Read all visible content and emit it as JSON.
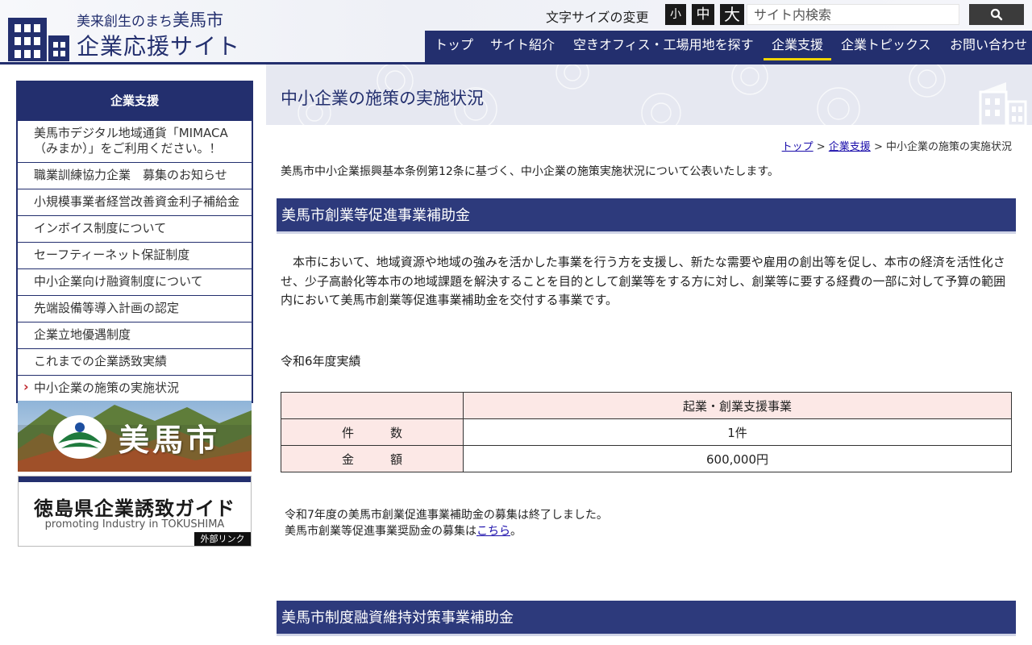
{
  "header": {
    "logo_sub": "美来創生のまち",
    "logo_city": "美馬市",
    "logo_main": "企業応援サイト",
    "font_size_label": "文字サイズの変更",
    "font_sizes": [
      "小",
      "中",
      "大"
    ],
    "search_placeholder": "サイト内検索",
    "search_icon": "search-icon"
  },
  "nav": {
    "items": [
      "トップ",
      "サイト紹介",
      "空きオフィス・工場用地を探す",
      "企業支援",
      "企業トピックス",
      "お問い合わせ"
    ],
    "active": "企業支援"
  },
  "sidebar": {
    "heading": "企業支援",
    "items": [
      "美馬市デジタル地域通貨「MIMACA（みまか）」をご利用ください。！",
      "職業訓練協力企業　募集のお知らせ",
      "小規模事業者経営改善資金利子補給金",
      "インボイス制度について",
      "セーフティーネット保証制度",
      "中小企業向け融資制度について",
      "先端設備等導入計画の認定",
      "企業立地優遇制度",
      "これまでの企業誘致実績",
      "中小企業の施策の実施状況"
    ],
    "banner1_text": "美馬市",
    "banner2_title": "徳島県企業誘致ガイド",
    "banner2_sub": "promoting Industry in TOKUSHIMA",
    "banner2_tag": "外部リンク"
  },
  "main": {
    "title": "中小企業の施策の実施状況",
    "breadcrumb": {
      "top": "トップ",
      "sep": " > ",
      "parent": "企業支援",
      "current": "中小企業の施策の実施状況"
    },
    "intro": "美馬市中小企業振興基本条例第12条に基づく、中小企業の施策実施状況について公表いたします。",
    "section1": {
      "heading": "美馬市創業等促進事業補助金",
      "paragraph": "　本市において、地域資源や地域の強みを活かした事業を行う方を支援し、新たな需要や雇用の創出等を促し、本市の経済を活性化させ、少子高齢化等本市の地域課題を解決することを目的として創業等をする方に対し、創業等に要する経費の一部に対して予算の範囲内において美馬市創業等促進事業補助金を交付する事業です。",
      "year_label": "令和6年度実績",
      "table": {
        "header": [
          "",
          "起業・創業支援事業"
        ],
        "rows": [
          [
            "件　　　数",
            "1件"
          ],
          [
            "金　　　額",
            "600,000円"
          ]
        ]
      },
      "notice_line1": "令和7年度の美馬市創業促進事業補助金の募集は終了しました。",
      "notice_line2_pre": "美馬市創業等促進事業奨励金の募集は",
      "notice_link": "こちら",
      "notice_line2_post": "。"
    },
    "section2": {
      "heading": "美馬市制度融資維持対策事業補助金"
    }
  }
}
